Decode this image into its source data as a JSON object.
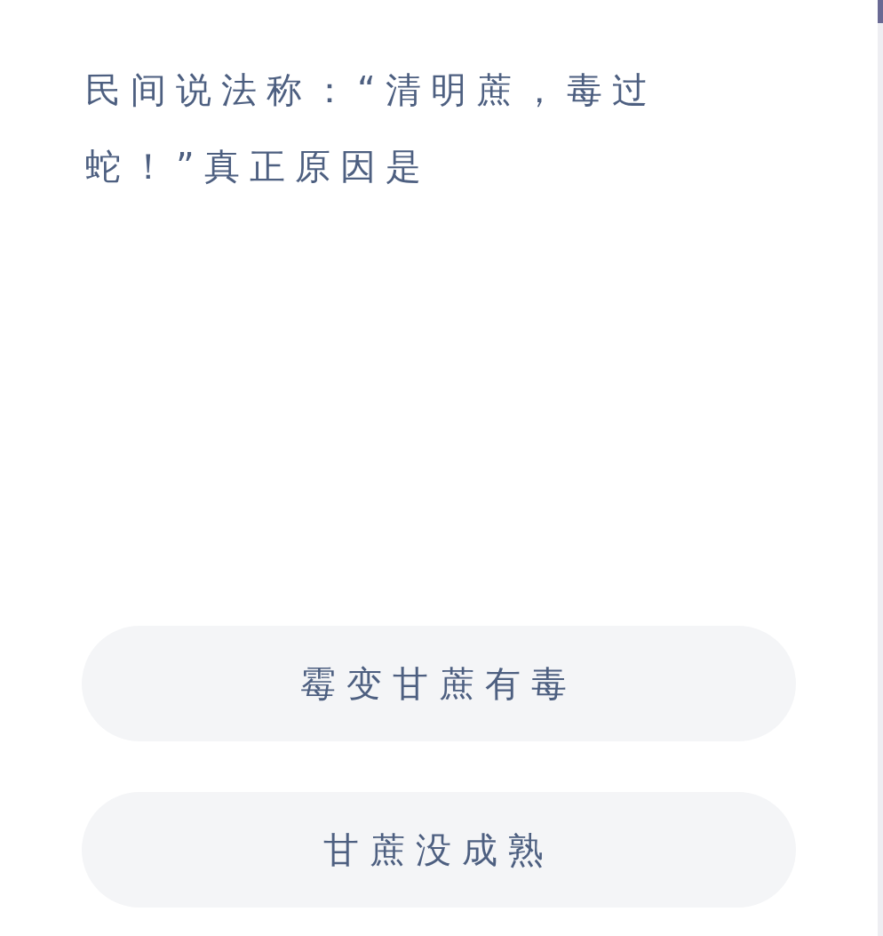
{
  "question": "民间说法称：“清明蔗，毒过蛇！”真正原因是",
  "options": [
    {
      "label": "霉变甘蔗有毒"
    },
    {
      "label": "甘蔗没成熟"
    }
  ]
}
